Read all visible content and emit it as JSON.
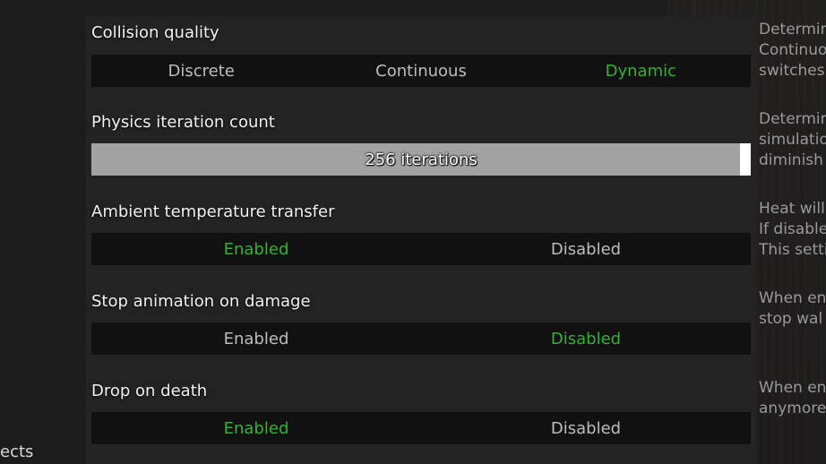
{
  "settings": [
    {
      "title": "Collision quality",
      "options": [
        "Discrete",
        "Continuous",
        "Dynamic"
      ],
      "selected": "Dynamic",
      "description_lines": [
        "Determin",
        "Continuo",
        "switches"
      ]
    },
    {
      "title": "Physics iteration count",
      "slider_label": "256 iterations",
      "slider_fill_fraction": 0.984,
      "description_lines": [
        "Determin",
        "simulatio",
        "diminish"
      ]
    },
    {
      "title": "Ambient temperature transfer",
      "options": [
        "Enabled",
        "Disabled"
      ],
      "selected": "Enabled",
      "description_lines": [
        "Heat will",
        "If disable",
        "This setti"
      ]
    },
    {
      "title": "Stop animation on damage",
      "options": [
        "Enabled",
        "Disabled"
      ],
      "selected": "Disabled",
      "description_lines": [
        "When en",
        "stop wal"
      ]
    },
    {
      "title": "Drop on death",
      "options": [
        "Enabled",
        "Disabled"
      ],
      "selected": "Enabled",
      "description_lines": [
        "When en",
        "anymore"
      ]
    }
  ],
  "colors": {
    "active": "#2fb52f",
    "inactive": "#bdbdbd",
    "slider_fill": "#a2a2a2"
  },
  "corner_label": "ects"
}
